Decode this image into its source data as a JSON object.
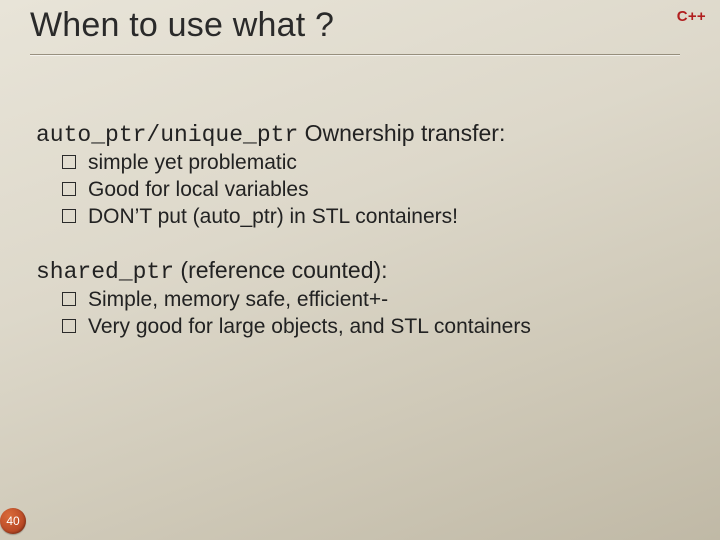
{
  "badge": "C++",
  "title": "When to use what ?",
  "sections": [
    {
      "heading_mono": "auto_ptr/unique_ptr",
      "heading_rest": " Ownership transfer:",
      "bullets": [
        "simple yet problematic",
        "Good for local variables",
        "DON’T put (auto_ptr) in STL containers!"
      ]
    },
    {
      "heading_mono": "shared_ptr",
      "heading_rest": " (reference counted):",
      "bullets": [
        "Simple, memory safe, efficient+-",
        "Very good for large objects, and STL containers"
      ]
    }
  ],
  "page_number": "40"
}
